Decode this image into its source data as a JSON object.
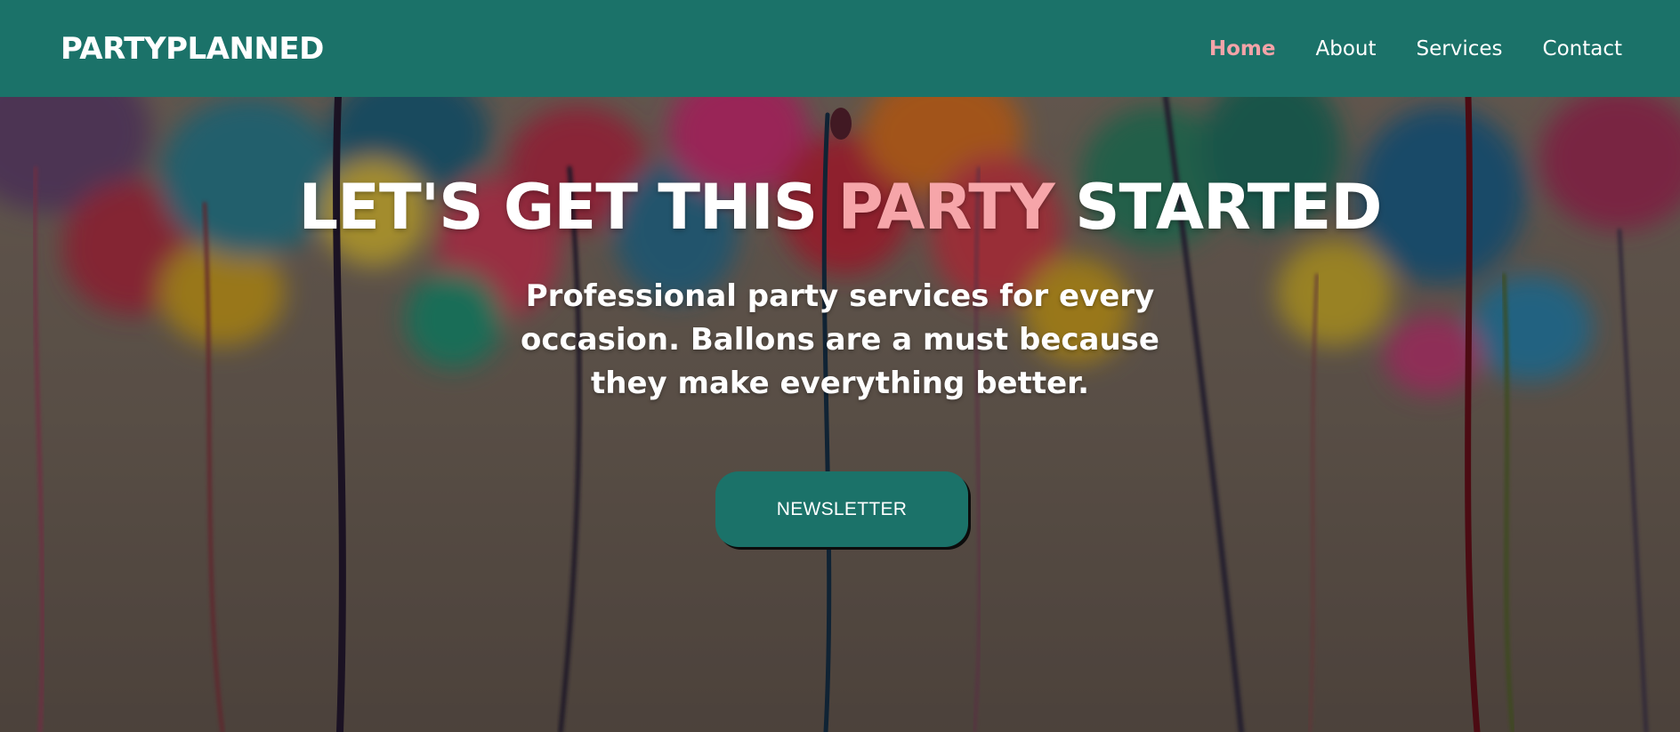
{
  "navbar": {
    "brand": "PARTYPLANNED",
    "links": [
      {
        "label": "Home",
        "active": true
      },
      {
        "label": "About",
        "active": false
      },
      {
        "label": "Services",
        "active": false
      },
      {
        "label": "Contact",
        "active": false
      }
    ]
  },
  "hero": {
    "headline_part1": "LET'S GET THIS",
    "headline_accent": "PARTY",
    "headline_part2": "STARTED",
    "subtitle": "Professional party services for every occasion. Ballons are a must because they make everything better.",
    "cta_label": "NEWSLETTER",
    "background_image": "blurred colorful balloons with hanging ribbons"
  },
  "colors": {
    "primary": "#1b7269",
    "accent": "#f4a3a8",
    "text": "#ffffff"
  }
}
